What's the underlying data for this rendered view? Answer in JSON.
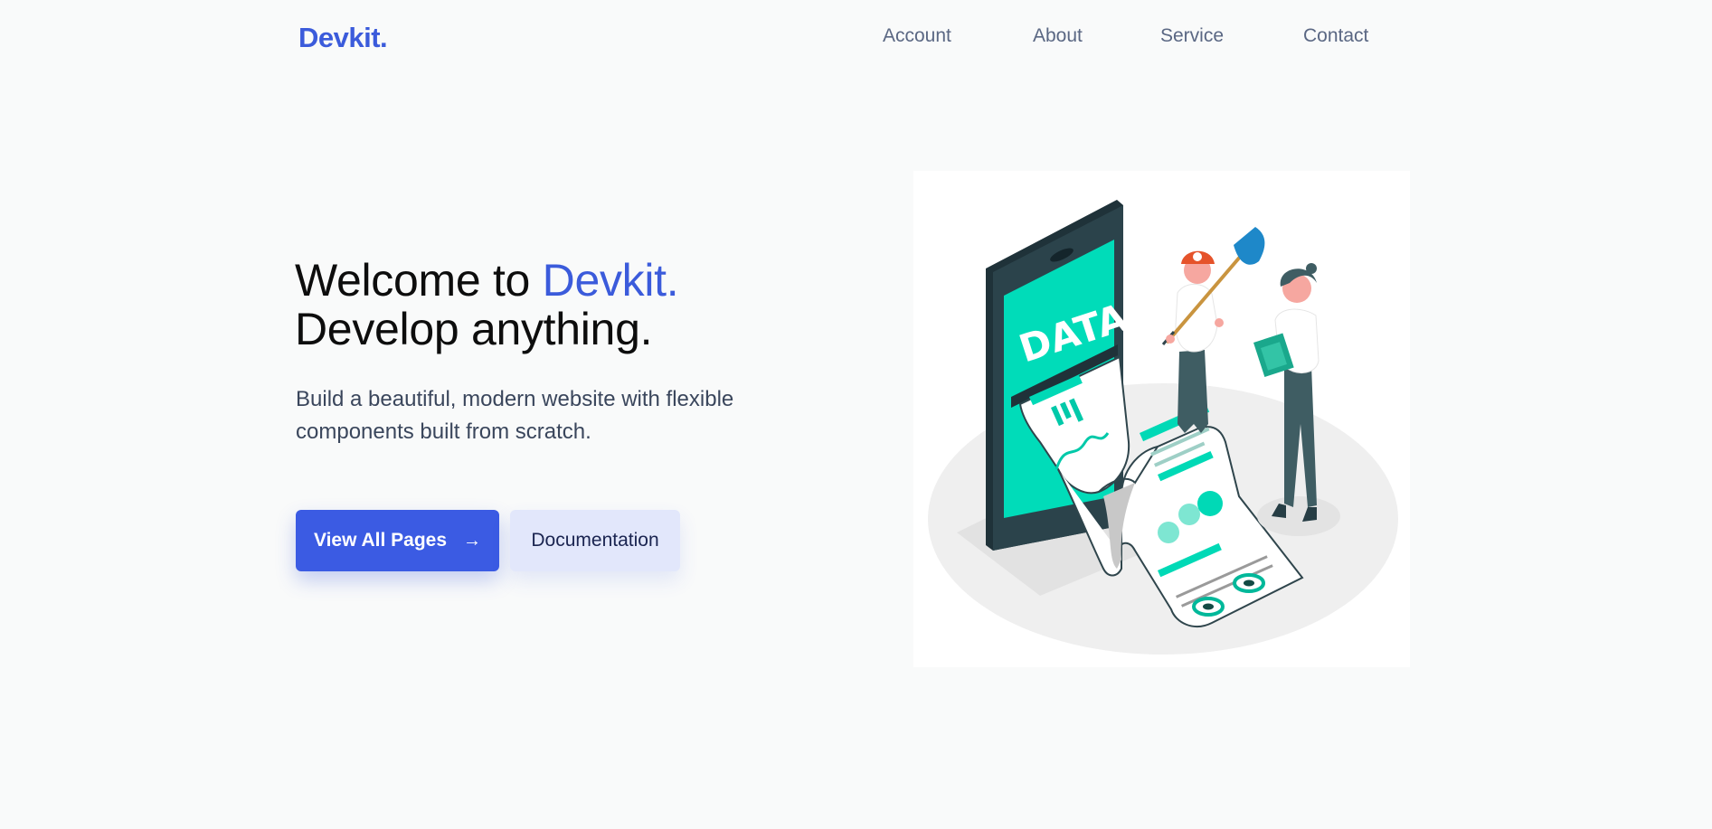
{
  "brand": {
    "logo": "Devkit."
  },
  "nav": {
    "items": [
      "Account",
      "About",
      "Service",
      "Contact"
    ]
  },
  "hero": {
    "title_prefix": "Welcome to ",
    "title_accent": "Devkit.",
    "title_line2": "Develop anything.",
    "subtitle": "Build a beautiful, modern website with flexible components built from scratch.",
    "primary_button": "View All Pages",
    "primary_icon": "arrow-right-icon",
    "secondary_button": "Documentation"
  },
  "illustration": {
    "phone_label": "DATA",
    "colors": {
      "accent": "#3b5bdb",
      "teal": "#00d9b6",
      "phone": "#263d44",
      "helmet": "#e5532b"
    }
  }
}
